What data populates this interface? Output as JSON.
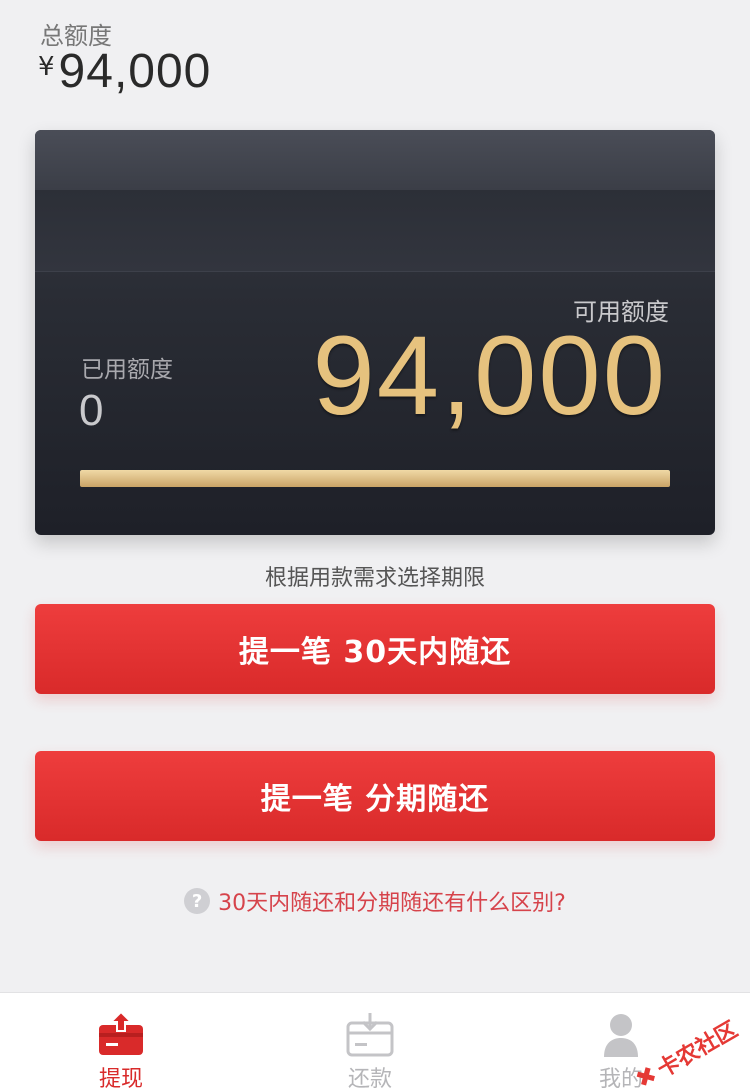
{
  "header": {
    "total_label": "总额度",
    "currency": "¥",
    "total_amount": "94,000"
  },
  "card": {
    "available_label": "可用额度",
    "available_value": "94,000",
    "used_label": "已用额度",
    "used_value": "0",
    "progress_fraction": 1.0
  },
  "hint": "根据用款需求选择期限",
  "buttons": {
    "thirty_day": "提一笔 30天内随还",
    "installment": "提一笔 分期随还"
  },
  "faq": {
    "icon": "?",
    "text": "30天内随还和分期随还有什么区别?"
  },
  "tabbar": {
    "items": [
      {
        "label": "提现",
        "icon": "withdraw-icon",
        "active": true
      },
      {
        "label": "还款",
        "icon": "repay-icon",
        "active": false
      },
      {
        "label": "我的",
        "icon": "profile-icon",
        "active": false
      }
    ]
  },
  "watermark": "卡农社区",
  "colors": {
    "accent": "#d92a2a",
    "gold": "#e6c27e",
    "card_dark": "#1e2028"
  }
}
